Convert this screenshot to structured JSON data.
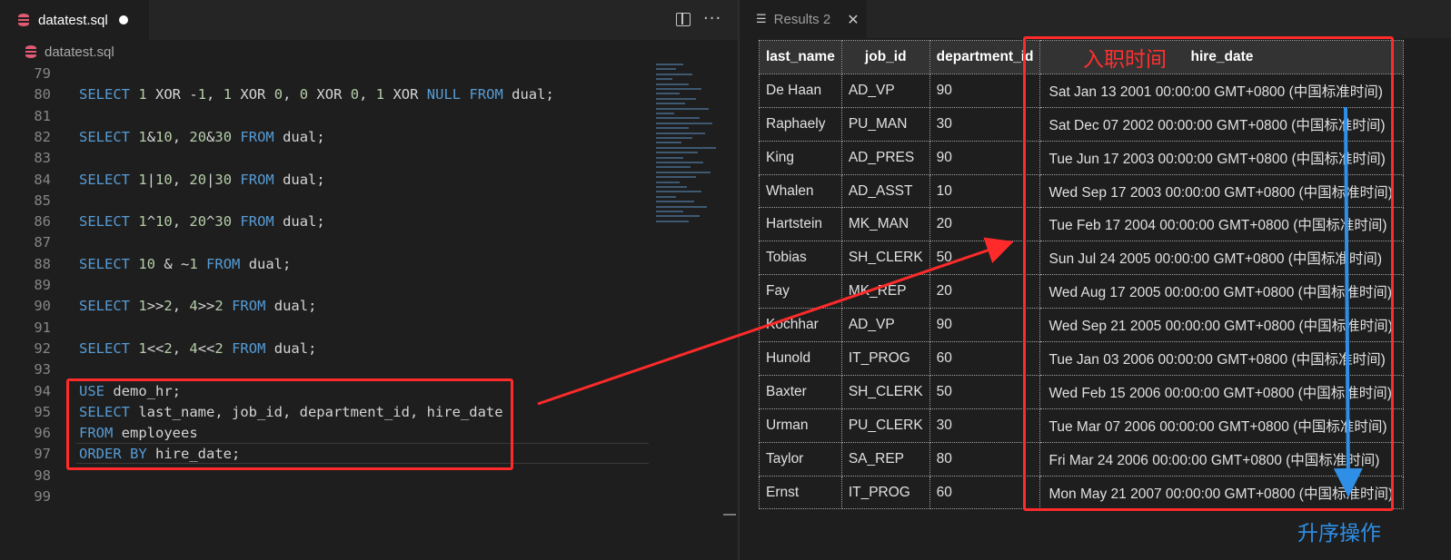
{
  "editor": {
    "tab_filename": "datatest.sql",
    "breadcrumb": "datatest.sql",
    "more_actions": "···",
    "lines": [
      {
        "num": "79",
        "tokens": []
      },
      {
        "num": "80",
        "tokens": [
          {
            "t": "SELECT",
            "c": "kw"
          },
          {
            "t": " "
          },
          {
            "t": "1",
            "c": "num"
          },
          {
            "t": " XOR -"
          },
          {
            "t": "1",
            "c": "num"
          },
          {
            "t": ", "
          },
          {
            "t": "1",
            "c": "num"
          },
          {
            "t": " XOR "
          },
          {
            "t": "0",
            "c": "num"
          },
          {
            "t": ", "
          },
          {
            "t": "0",
            "c": "num"
          },
          {
            "t": " XOR "
          },
          {
            "t": "0",
            "c": "num"
          },
          {
            "t": ", "
          },
          {
            "t": "1",
            "c": "num"
          },
          {
            "t": " XOR "
          },
          {
            "t": "NULL",
            "c": "kw"
          },
          {
            "t": " "
          },
          {
            "t": "FROM",
            "c": "kw"
          },
          {
            "t": " dual;"
          }
        ]
      },
      {
        "num": "81",
        "tokens": []
      },
      {
        "num": "82",
        "tokens": [
          {
            "t": "SELECT",
            "c": "kw"
          },
          {
            "t": " "
          },
          {
            "t": "1",
            "c": "num"
          },
          {
            "t": "&"
          },
          {
            "t": "10",
            "c": "num"
          },
          {
            "t": ", "
          },
          {
            "t": "20",
            "c": "num"
          },
          {
            "t": "&"
          },
          {
            "t": "30",
            "c": "num"
          },
          {
            "t": " "
          },
          {
            "t": "FROM",
            "c": "kw"
          },
          {
            "t": " dual;"
          }
        ]
      },
      {
        "num": "83",
        "tokens": []
      },
      {
        "num": "84",
        "tokens": [
          {
            "t": "SELECT",
            "c": "kw"
          },
          {
            "t": " "
          },
          {
            "t": "1",
            "c": "num"
          },
          {
            "t": "|"
          },
          {
            "t": "10",
            "c": "num"
          },
          {
            "t": ", "
          },
          {
            "t": "20",
            "c": "num"
          },
          {
            "t": "|"
          },
          {
            "t": "30",
            "c": "num"
          },
          {
            "t": " "
          },
          {
            "t": "FROM",
            "c": "kw"
          },
          {
            "t": " dual;"
          }
        ]
      },
      {
        "num": "85",
        "tokens": []
      },
      {
        "num": "86",
        "tokens": [
          {
            "t": "SELECT",
            "c": "kw"
          },
          {
            "t": " "
          },
          {
            "t": "1",
            "c": "num"
          },
          {
            "t": "^"
          },
          {
            "t": "10",
            "c": "num"
          },
          {
            "t": ", "
          },
          {
            "t": "20",
            "c": "num"
          },
          {
            "t": "^"
          },
          {
            "t": "30",
            "c": "num"
          },
          {
            "t": " "
          },
          {
            "t": "FROM",
            "c": "kw"
          },
          {
            "t": " dual;"
          }
        ]
      },
      {
        "num": "87",
        "tokens": []
      },
      {
        "num": "88",
        "tokens": [
          {
            "t": "SELECT",
            "c": "kw"
          },
          {
            "t": " "
          },
          {
            "t": "10",
            "c": "num"
          },
          {
            "t": " & ~"
          },
          {
            "t": "1",
            "c": "num"
          },
          {
            "t": " "
          },
          {
            "t": "FROM",
            "c": "kw"
          },
          {
            "t": " dual;"
          }
        ]
      },
      {
        "num": "89",
        "tokens": []
      },
      {
        "num": "90",
        "tokens": [
          {
            "t": "SELECT",
            "c": "kw"
          },
          {
            "t": " "
          },
          {
            "t": "1",
            "c": "num"
          },
          {
            "t": ">>"
          },
          {
            "t": "2",
            "c": "num"
          },
          {
            "t": ", "
          },
          {
            "t": "4",
            "c": "num"
          },
          {
            "t": ">>"
          },
          {
            "t": "2",
            "c": "num"
          },
          {
            "t": " "
          },
          {
            "t": "FROM",
            "c": "kw"
          },
          {
            "t": " dual;"
          }
        ]
      },
      {
        "num": "91",
        "tokens": []
      },
      {
        "num": "92",
        "tokens": [
          {
            "t": "SELECT",
            "c": "kw"
          },
          {
            "t": " "
          },
          {
            "t": "1",
            "c": "num"
          },
          {
            "t": "<<"
          },
          {
            "t": "2",
            "c": "num"
          },
          {
            "t": ", "
          },
          {
            "t": "4",
            "c": "num"
          },
          {
            "t": "<<"
          },
          {
            "t": "2",
            "c": "num"
          },
          {
            "t": " "
          },
          {
            "t": "FROM",
            "c": "kw"
          },
          {
            "t": " dual;"
          }
        ]
      },
      {
        "num": "93",
        "tokens": []
      },
      {
        "num": "94",
        "tokens": [
          {
            "t": "USE",
            "c": "kw"
          },
          {
            "t": " demo_hr;"
          }
        ]
      },
      {
        "num": "95",
        "tokens": [
          {
            "t": "SELECT",
            "c": "kw"
          },
          {
            "t": " last_name, job_id, department_id, hire_date"
          }
        ]
      },
      {
        "num": "96",
        "tokens": [
          {
            "t": "FROM",
            "c": "kw"
          },
          {
            "t": " employees"
          }
        ]
      },
      {
        "num": "97",
        "tokens": [
          {
            "t": "ORDER",
            "c": "kw"
          },
          {
            "t": " "
          },
          {
            "t": "BY",
            "c": "kw"
          },
          {
            "t": " hire_date;"
          }
        ]
      },
      {
        "num": "98",
        "tokens": []
      },
      {
        "num": "99",
        "tokens": []
      }
    ]
  },
  "results": {
    "tab_label": "Results 2",
    "close_glyph": "✕",
    "columns": [
      "last_name",
      "job_id",
      "department_id",
      "hire_date"
    ],
    "rows": [
      [
        "De Haan",
        "AD_VP",
        "90",
        "Sat Jan 13 2001 00:00:00 GMT+0800 (中国标准时间)"
      ],
      [
        "Raphaely",
        "PU_MAN",
        "30",
        "Sat Dec 07 2002 00:00:00 GMT+0800 (中国标准时间)"
      ],
      [
        "King",
        "AD_PRES",
        "90",
        "Tue Jun 17 2003 00:00:00 GMT+0800 (中国标准时间)"
      ],
      [
        "Whalen",
        "AD_ASST",
        "10",
        "Wed Sep 17 2003 00:00:00 GMT+0800 (中国标准时间)"
      ],
      [
        "Hartstein",
        "MK_MAN",
        "20",
        "Tue Feb 17 2004 00:00:00 GMT+0800 (中国标准时间)"
      ],
      [
        "Tobias",
        "SH_CLERK",
        "50",
        "Sun Jul 24 2005 00:00:00 GMT+0800 (中国标准时间)"
      ],
      [
        "Fay",
        "MK_REP",
        "20",
        "Wed Aug 17 2005 00:00:00 GMT+0800 (中国标准时间)"
      ],
      [
        "Kochhar",
        "AD_VP",
        "90",
        "Wed Sep 21 2005 00:00:00 GMT+0800 (中国标准时间)"
      ],
      [
        "Hunold",
        "IT_PROG",
        "60",
        "Tue Jan 03 2006 00:00:00 GMT+0800 (中国标准时间)"
      ],
      [
        "Baxter",
        "SH_CLERK",
        "50",
        "Wed Feb 15 2006 00:00:00 GMT+0800 (中国标准时间)"
      ],
      [
        "Urman",
        "PU_CLERK",
        "30",
        "Tue Mar 07 2006 00:00:00 GMT+0800 (中国标准时间)"
      ],
      [
        "Taylor",
        "SA_REP",
        "80",
        "Fri Mar 24 2006 00:00:00 GMT+0800 (中国标准时间)"
      ],
      [
        "Ernst",
        "IT_PROG",
        "60",
        "Mon May 21 2007 00:00:00 GMT+0800 (中国标准时间)"
      ]
    ]
  },
  "annotations": {
    "hire_date_label": "入职时间",
    "ascending_label": "升序操作",
    "red_color": "#ff2a2a",
    "blue_color": "#2f8fe6"
  },
  "colors": {
    "keyword": "#569cd6",
    "number": "#b5cea8",
    "identifier": "#d4d4d4",
    "line_number": "#858585",
    "db_icon": "#e05a73"
  }
}
